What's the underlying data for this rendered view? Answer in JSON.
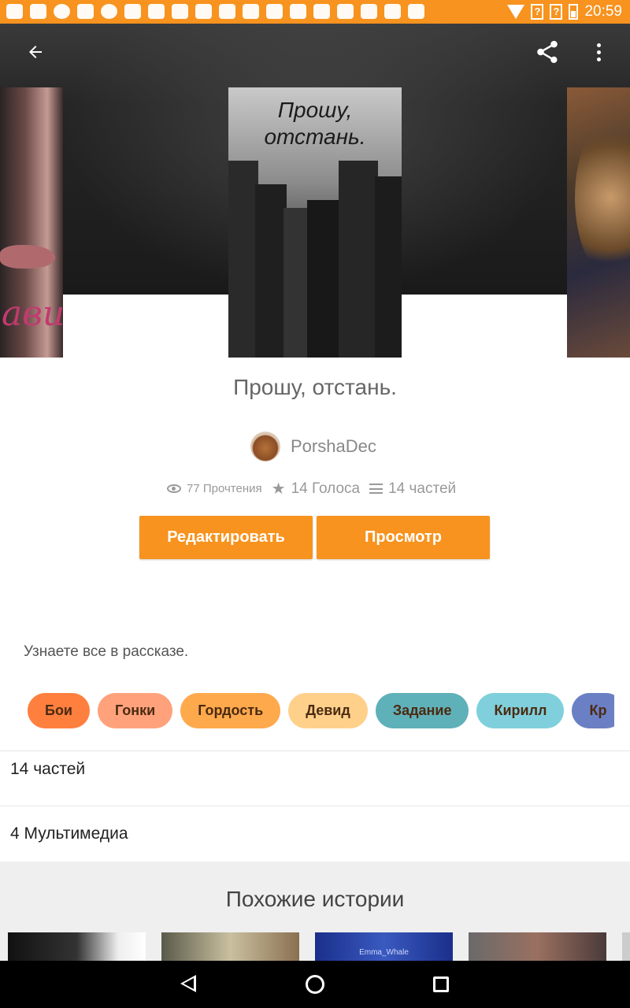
{
  "status_bar": {
    "time": "20:59",
    "icons": [
      "message-icon",
      "antenna-icon",
      "game-icon",
      "image-icon",
      "app-icon",
      "yandex-icon",
      "car-icon",
      "heart-icon",
      "heart-icon",
      "car-icon",
      "heart-icon",
      "youtube-icon",
      "youtube-icon",
      "youtube-icon",
      "youtube-icon",
      "youtube-icon",
      "youtube-icon",
      "youtube-icon",
      "wifi-icon",
      "no-sim-icon",
      "battery-icon"
    ]
  },
  "appbar": {
    "back_icon": "arrow-back-icon",
    "share_icon": "share-icon",
    "more_icon": "more-vert-icon"
  },
  "covers": {
    "left_text": "ави",
    "main_title_line1": "Прошу,",
    "main_title_line2": "отстань."
  },
  "story": {
    "title": "Прошу, отстань.",
    "author": "PorshaDec",
    "reads": "77 Прочтения",
    "votes": "14 Голоса",
    "parts": "14 частей"
  },
  "buttons": {
    "edit": "Редактировать",
    "view": "Просмотр"
  },
  "description": "Узнаете все в рассказе.",
  "tags": [
    {
      "label": "Бои",
      "color": "#ff7f3f"
    },
    {
      "label": "Гонки",
      "color": "#ffa27c"
    },
    {
      "label": "Гордость",
      "color": "#ffa94d"
    },
    {
      "label": "Девид",
      "color": "#ffd08a"
    },
    {
      "label": "Задание",
      "color": "#5fb1b9"
    },
    {
      "label": "Кирилл",
      "color": "#7fd0dc"
    },
    {
      "label": "Кр",
      "color": "#6b7fc4"
    }
  ],
  "sections": {
    "parts_row": "14 частей",
    "media_row": "4 Мультимедиа"
  },
  "similar": {
    "title": "Похожие истории",
    "thumb_text": "Emma_Whale"
  },
  "navbar": {
    "back_icon": "nav-back-icon",
    "home_icon": "nav-home-icon",
    "recent_icon": "nav-recent-icon"
  }
}
